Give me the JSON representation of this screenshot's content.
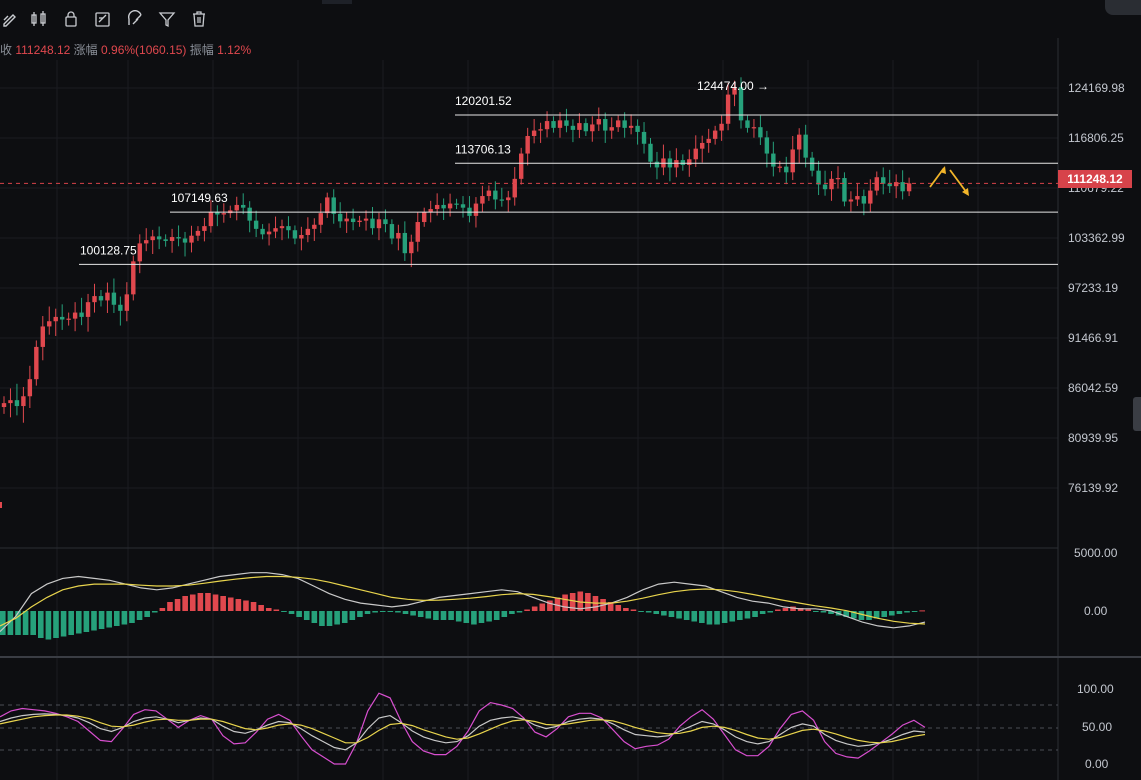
{
  "info": {
    "close_label": "收",
    "close_value": "111248.12",
    "change_label": "涨幅",
    "change_value": "0.96%(1060.15)",
    "amplitude_label": "振幅",
    "amplitude_value": "1.12%"
  },
  "toolbar": {
    "icons": [
      "pencil-icon",
      "candlestick-icon",
      "lock-icon",
      "edit-icon",
      "magnet-icon",
      "filter-icon",
      "trash-icon"
    ]
  },
  "colors": {
    "up": "#e0484e",
    "down": "#26a17b",
    "dif": "#c9c9c9",
    "dea": "#e8d44d",
    "j": "#d84fcf",
    "arrow": "#f2b52a"
  },
  "chart_data": [
    {
      "type": "candlestick",
      "y_ticks": [
        "124169.98",
        "116806.25",
        "110679.22",
        "103362.99",
        "97233.19",
        "91466.91",
        "86042.59",
        "80939.95",
        "76139.92"
      ],
      "last_price": "111248.12",
      "levels": [
        {
          "label": "120201.52",
          "value": 120201.52
        },
        {
          "label": "113706.13",
          "value": 113706.13
        },
        {
          "label": "107149.63",
          "value": 107149.63
        },
        {
          "label": "100128.75",
          "value": 100128.75
        }
      ],
      "high_marker": {
        "label": "124474.00",
        "value": 124474.0
      },
      "closes": [
        84500,
        84800,
        84200,
        85200,
        87000,
        90500,
        92800,
        93400,
        93900,
        93600,
        93700,
        94400,
        93900,
        95600,
        96300,
        95800,
        96700,
        95300,
        94600,
        96500,
        100500,
        102700,
        103100,
        103600,
        103200,
        103000,
        103500,
        103300,
        102800,
        103700,
        104400,
        105100,
        107200,
        106800,
        107000,
        107400,
        108200,
        107800,
        105900,
        104700,
        103900,
        104300,
        104800,
        105100,
        104500,
        103300,
        103800,
        104700,
        105300,
        107000,
        109300,
        106900,
        105800,
        106200,
        105700,
        105900,
        106200,
        104800,
        106100,
        105400,
        103300,
        104100,
        101500,
        102900,
        105700,
        107100,
        107600,
        108200,
        107700,
        108400,
        108300,
        107800,
        106600,
        108400,
        109500,
        110300,
        109000,
        108900,
        109300,
        111800,
        114900,
        117100,
        117900,
        118100,
        119300,
        118300,
        119400,
        118600,
        118000,
        119000,
        117800,
        118800,
        119600,
        117900,
        118400,
        119400,
        118300,
        118600,
        117700,
        116100,
        113900,
        113200,
        114300,
        113200,
        114100,
        113500,
        114200,
        115500,
        116200,
        116700,
        117900,
        118900,
        123200,
        124300,
        119400,
        118300,
        118400,
        116900,
        114900,
        113300,
        113300,
        112600,
        115400,
        117300,
        114400,
        112800,
        111100,
        110500,
        111800,
        111900,
        108700,
        109000,
        109500,
        108400,
        110300,
        112000,
        111200,
        110900,
        111400,
        110200,
        111248
      ],
      "macd": {
        "y_ticks": [
          "5000.00",
          "0.00"
        ],
        "hist_heights": [
          -0.8,
          -0.8,
          -0.8,
          -0.8,
          -0.8,
          -0.9,
          -0.95,
          -0.9,
          -0.85,
          -0.8,
          -0.75,
          -0.7,
          -0.65,
          -0.6,
          -0.55,
          -0.5,
          -0.45,
          -0.4,
          -0.3,
          -0.2,
          -0.05,
          0.1,
          0.3,
          0.4,
          0.5,
          0.55,
          0.6,
          0.6,
          0.55,
          0.5,
          0.45,
          0.4,
          0.35,
          0.3,
          0.2,
          0.1,
          0.05,
          -0.02,
          -0.1,
          -0.2,
          -0.3,
          -0.4,
          -0.5,
          -0.5,
          -0.45,
          -0.4,
          -0.3,
          -0.2,
          -0.1,
          -0.05,
          -0.02,
          -0.02,
          -0.05,
          -0.1,
          -0.15,
          -0.2,
          -0.25,
          -0.3,
          -0.3,
          -0.3,
          -0.35,
          -0.4,
          -0.45,
          -0.4,
          -0.35,
          -0.3,
          -0.2,
          -0.1,
          -0.05,
          0.05,
          0.15,
          0.25,
          0.35,
          0.45,
          0.55,
          0.6,
          0.65,
          0.6,
          0.5,
          0.4,
          0.3,
          0.2,
          0.1,
          0.05,
          -0.02,
          -0.05,
          -0.1,
          -0.15,
          -0.2,
          -0.25,
          -0.3,
          -0.35,
          -0.4,
          -0.45,
          -0.45,
          -0.4,
          -0.35,
          -0.3,
          -0.25,
          -0.2,
          -0.1,
          -0.05,
          0.05,
          0.1,
          0.15,
          0.1,
          0.05,
          -0.02,
          -0.05,
          -0.1,
          -0.15,
          -0.2,
          -0.25,
          -0.3,
          -0.3,
          -0.25,
          -0.2,
          -0.15,
          -0.1,
          -0.05,
          -0.02,
          0.02
        ],
        "dif": [
          -0.7,
          -0.3,
          0.3,
          0.55,
          0.7,
          0.75,
          0.7,
          0.65,
          0.55,
          0.45,
          0.4,
          0.45,
          0.55,
          0.65,
          0.75,
          0.8,
          0.85,
          0.85,
          0.8,
          0.7,
          0.5,
          0.3,
          0.15,
          0.05,
          0.0,
          -0.05,
          0.0,
          0.1,
          0.2,
          0.25,
          0.3,
          0.35,
          0.4,
          0.35,
          0.2,
          0.05,
          -0.05,
          -0.1,
          -0.05,
          0.05,
          0.2,
          0.4,
          0.55,
          0.6,
          0.55,
          0.5,
          0.35,
          0.2,
          0.1,
          0.05,
          -0.05,
          -0.1,
          -0.1,
          -0.15,
          -0.3,
          -0.45,
          -0.55,
          -0.6,
          -0.55,
          -0.45
        ],
        "dea": [
          -0.55,
          -0.35,
          -0.05,
          0.2,
          0.4,
          0.5,
          0.55,
          0.55,
          0.55,
          0.52,
          0.5,
          0.5,
          0.52,
          0.57,
          0.63,
          0.68,
          0.72,
          0.75,
          0.75,
          0.73,
          0.68,
          0.6,
          0.5,
          0.4,
          0.3,
          0.2,
          0.15,
          0.12,
          0.13,
          0.15,
          0.18,
          0.22,
          0.27,
          0.3,
          0.28,
          0.22,
          0.15,
          0.08,
          0.05,
          0.05,
          0.1,
          0.18,
          0.27,
          0.35,
          0.4,
          0.42,
          0.4,
          0.35,
          0.28,
          0.2,
          0.12,
          0.05,
          -0.02,
          -0.08,
          -0.15,
          -0.25,
          -0.35,
          -0.43,
          -0.48,
          -0.5
        ]
      },
      "kdj": {
        "y_ticks": [
          "100.00",
          "50.00",
          "0.00"
        ],
        "k": [
          72,
          78,
          82,
          84,
          85,
          84,
          82,
          78,
          70,
          60,
          55,
          62,
          72,
          78,
          80,
          76,
          70,
          74,
          78,
          76,
          64,
          55,
          52,
          58,
          66,
          72,
          70,
          60,
          48,
          38,
          28,
          24,
          36,
          60,
          78,
          82,
          70,
          56,
          46,
          40,
          36,
          38,
          48,
          64,
          74,
          78,
          80,
          76,
          66,
          60,
          64,
          72,
          76,
          78,
          76,
          68,
          58,
          50,
          48,
          46,
          48,
          56,
          64,
          72,
          68,
          58,
          46,
          38,
          34,
          38,
          50,
          62,
          68,
          64,
          50,
          40,
          34,
          30,
          32,
          36,
          42,
          50,
          56,
          54
        ],
        "d": [
          68,
          72,
          76,
          80,
          82,
          83,
          83,
          81,
          77,
          70,
          64,
          63,
          66,
          71,
          75,
          76,
          74,
          74,
          76,
          76,
          72,
          66,
          60,
          58,
          61,
          66,
          68,
          66,
          60,
          52,
          44,
          36,
          36,
          45,
          57,
          67,
          69,
          65,
          58,
          52,
          46,
          42,
          44,
          51,
          59,
          67,
          73,
          75,
          72,
          67,
          66,
          68,
          71,
          74,
          75,
          73,
          68,
          62,
          57,
          53,
          51,
          52,
          56,
          62,
          64,
          62,
          57,
          50,
          44,
          42,
          45,
          51,
          57,
          59,
          56,
          51,
          45,
          40,
          37,
          36,
          38,
          42,
          47,
          50
        ],
        "j": [
          80,
          90,
          94,
          92,
          90,
          86,
          80,
          72,
          56,
          40,
          38,
          60,
          84,
          92,
          90,
          76,
          62,
          74,
          82,
          76,
          48,
          34,
          36,
          54,
          76,
          84,
          74,
          48,
          24,
          12,
          0,
          0,
          36,
          90,
          120,
          112,
          72,
          38,
          22,
          16,
          16,
          30,
          56,
          90,
          104,
          100,
          94,
          78,
          54,
          46,
          60,
          80,
          86,
          86,
          78,
          58,
          38,
          26,
          30,
          32,
          42,
          64,
          80,
          92,
          76,
          50,
          24,
          14,
          14,
          30,
          60,
          84,
          90,
          74,
          38,
          18,
          12,
          10,
          22,
          36,
          50,
          66,
          74,
          62
        ]
      }
    }
  ]
}
